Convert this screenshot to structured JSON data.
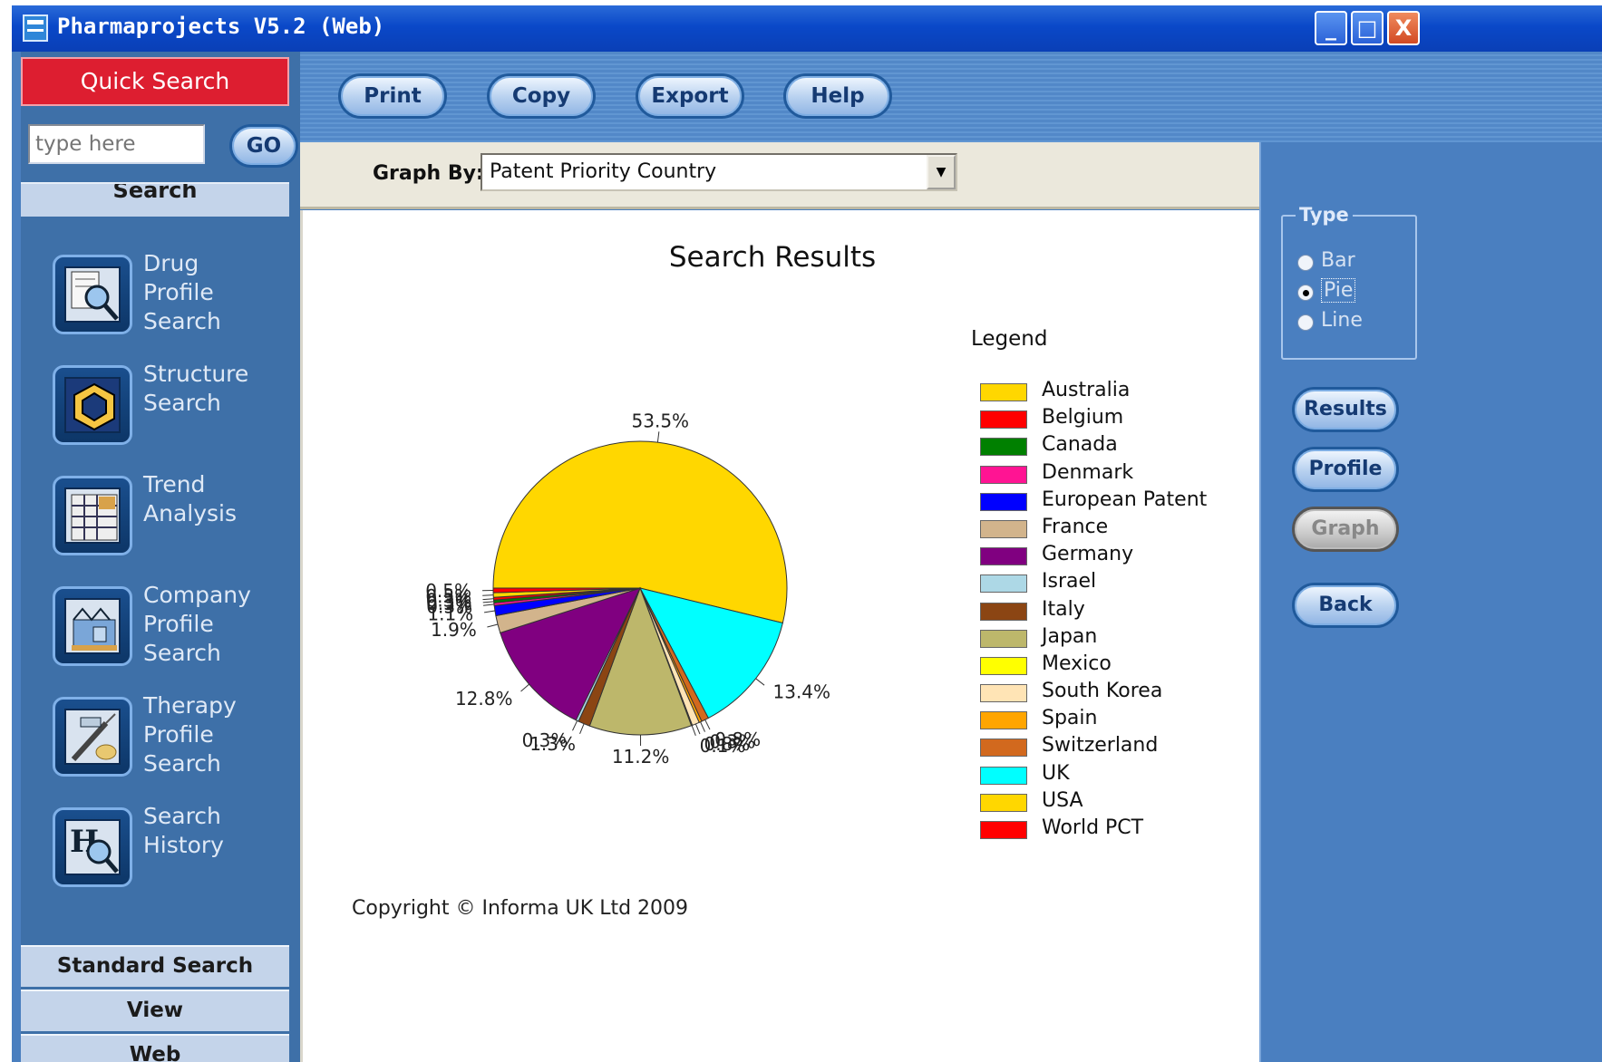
{
  "window": {
    "title": "Pharmaprojects V5.2 (Web)",
    "minimize_label": "_",
    "maximize_label": "□",
    "close_label": "X"
  },
  "sidebar": {
    "quick_search_label": "Quick Search",
    "search_placeholder": "type here",
    "go_label": "GO",
    "section_header": "Search",
    "items": [
      {
        "label": "Drug\nProfile\nSearch",
        "icon": "drug-profile-icon"
      },
      {
        "label": "Structure\nSearch",
        "icon": "structure-icon"
      },
      {
        "label": "Trend\nAnalysis",
        "icon": "trend-icon"
      },
      {
        "label": "Company\nProfile\nSearch",
        "icon": "company-icon"
      },
      {
        "label": "Therapy\nProfile\nSearch",
        "icon": "therapy-icon"
      },
      {
        "label": "Search\nHistory",
        "icon": "history-icon"
      }
    ],
    "bottom_tabs": [
      "Standard Search",
      "View",
      "Web"
    ]
  },
  "toolbar": {
    "print_label": "Print",
    "copy_label": "Copy",
    "export_label": "Export",
    "help_label": "Help"
  },
  "graph_by": {
    "label": "Graph By:",
    "selected": "Patent Priority Country"
  },
  "right_panel": {
    "type_label": "Type",
    "options": [
      "Bar",
      "Pie",
      "Line"
    ],
    "selected_option": "Pie",
    "results_label": "Results",
    "profile_label": "Profile",
    "graph_label": "Graph",
    "back_label": "Back"
  },
  "copyright": "Copyright © Informa UK Ltd 2009",
  "chart_data": {
    "type": "pie",
    "title": "Search Results",
    "legend_title": "Legend",
    "legend_position": "right",
    "slices": [
      {
        "name": "USA",
        "value": 53.5,
        "color": "#ffd700",
        "label": "53.5%"
      },
      {
        "name": "UK",
        "value": 13.4,
        "color": "#00ffff",
        "label": "13.4%"
      },
      {
        "name": "Switzerland",
        "value": 0.8,
        "color": "#d2691e",
        "label": "0.8%"
      },
      {
        "name": "Spain",
        "value": 0.3,
        "color": "#ffa500",
        "label": "0.3%"
      },
      {
        "name": "South Korea",
        "value": 0.8,
        "color": "#ffe4b5",
        "label": "0.8%"
      },
      {
        "name": "Mexico",
        "value": 0.1,
        "color": "#ffff00",
        "label": "0.1%"
      },
      {
        "name": "Japan",
        "value": 11.2,
        "color": "#bdb76b",
        "label": "11.2%"
      },
      {
        "name": "Italy",
        "value": 1.3,
        "color": "#8b4513",
        "label": "1.3%"
      },
      {
        "name": "Israel",
        "value": 0.3,
        "color": "#add8e6",
        "label": "0.3%"
      },
      {
        "name": "Germany",
        "value": 12.8,
        "color": "#800080",
        "label": "12.8%"
      },
      {
        "name": "France",
        "value": 1.9,
        "color": "#d2b48c",
        "label": "1.9%"
      },
      {
        "name": "European Patent",
        "value": 1.1,
        "color": "#0000ff",
        "label": "1.1%"
      },
      {
        "name": "Denmark",
        "value": 0.3,
        "color": "#ff1493",
        "label": "0.3%"
      },
      {
        "name": "Canada",
        "value": 0.3,
        "color": "#008000",
        "label": "0.3%"
      },
      {
        "name": "Belgium",
        "value": 0.3,
        "color": "#ff0000",
        "label": "0.3%"
      },
      {
        "name": "Australia",
        "value": 0.5,
        "color": "#ffd700",
        "label": "0.5%"
      },
      {
        "name": "World PCT",
        "value": 0.5,
        "color": "#ff0000",
        "label": "0.5%"
      }
    ],
    "legend": [
      {
        "name": "Australia",
        "color": "#ffd700"
      },
      {
        "name": "Belgium",
        "color": "#ff0000"
      },
      {
        "name": "Canada",
        "color": "#008000"
      },
      {
        "name": "Denmark",
        "color": "#ff1493"
      },
      {
        "name": "European Patent",
        "color": "#0000ff"
      },
      {
        "name": "France",
        "color": "#d2b48c"
      },
      {
        "name": "Germany",
        "color": "#800080"
      },
      {
        "name": "Israel",
        "color": "#add8e6"
      },
      {
        "name": "Italy",
        "color": "#8b4513"
      },
      {
        "name": "Japan",
        "color": "#bdb76b"
      },
      {
        "name": "Mexico",
        "color": "#ffff00"
      },
      {
        "name": "South Korea",
        "color": "#ffe4b5"
      },
      {
        "name": "Spain",
        "color": "#ffa500"
      },
      {
        "name": "Switzerland",
        "color": "#d2691e"
      },
      {
        "name": "UK",
        "color": "#00ffff"
      },
      {
        "name": "USA",
        "color": "#ffd700"
      },
      {
        "name": "World PCT",
        "color": "#ff0000"
      }
    ]
  }
}
